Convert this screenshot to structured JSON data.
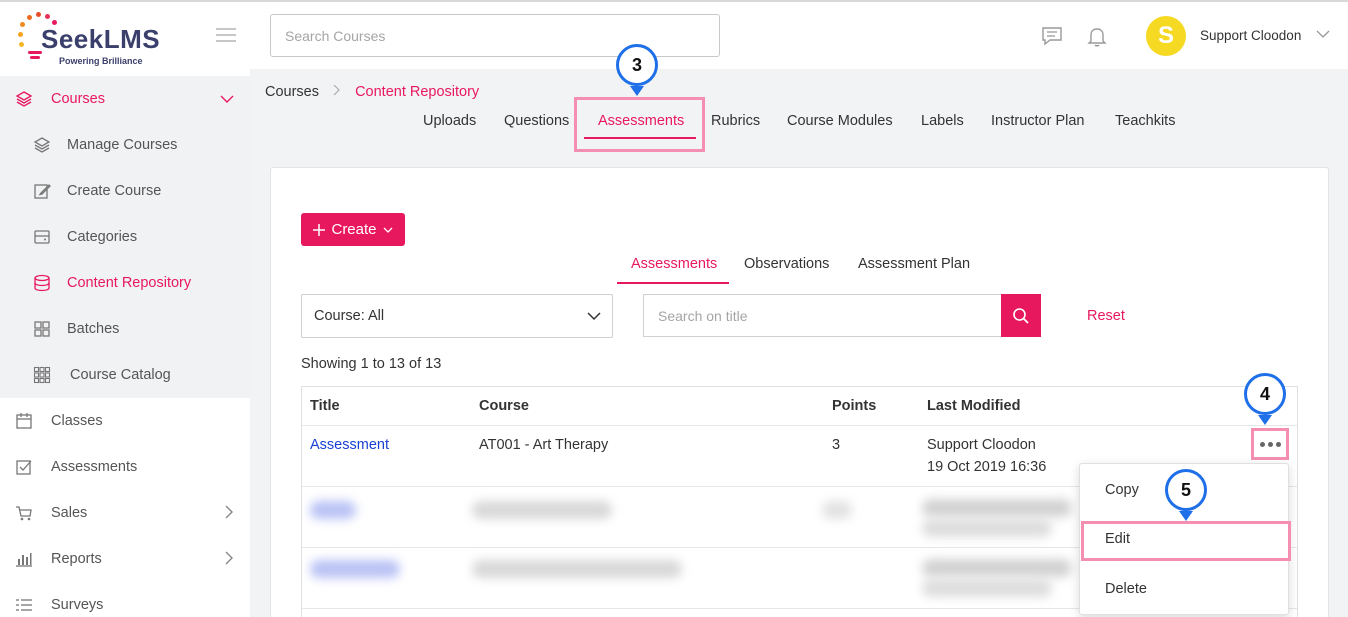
{
  "brand": {
    "name": "SeekLMS",
    "tagline": "Powering Brilliance"
  },
  "header": {
    "search_placeholder": "Search Courses",
    "user_name": "Support Cloodon",
    "user_initial": "S"
  },
  "sidebar": {
    "items": [
      {
        "label": "Courses",
        "icon": "layers-icon",
        "active": true,
        "expanded": true
      },
      {
        "label": "Manage Courses",
        "icon": "layers-icon",
        "sub": true
      },
      {
        "label": "Create Course",
        "icon": "edit-icon",
        "sub": true
      },
      {
        "label": "Categories",
        "icon": "server-icon",
        "sub": true
      },
      {
        "label": "Content Repository",
        "icon": "database-icon",
        "sub": true,
        "active": true
      },
      {
        "label": "Batches",
        "icon": "grid-icon",
        "sub": true
      },
      {
        "label": "Course Catalog",
        "icon": "apps-icon",
        "sub": true
      },
      {
        "label": "Classes",
        "icon": "calendar-icon"
      },
      {
        "label": "Assessments",
        "icon": "checkbox-icon"
      },
      {
        "label": "Sales",
        "icon": "cart-icon"
      },
      {
        "label": "Reports",
        "icon": "bar-chart-icon"
      },
      {
        "label": "Surveys",
        "icon": "list-icon"
      }
    ]
  },
  "breadcrumb": {
    "root": "Courses",
    "current": "Content Repository"
  },
  "repo_tabs": [
    "Uploads",
    "Questions",
    "Assessments",
    "Rubrics",
    "Course Modules",
    "Labels",
    "Instructor Plan",
    "Teachkits"
  ],
  "repo_tab_active": "Assessments",
  "create_label": "Create",
  "sub_tabs": [
    "Assessments",
    "Observations",
    "Assessment Plan"
  ],
  "filters": {
    "course_select": "Course: All",
    "title_placeholder": "Search on title",
    "reset_label": "Reset"
  },
  "showing_text": "Showing 1 to 13 of 13",
  "table": {
    "columns": [
      "Title",
      "Course",
      "Points",
      "Last Modified"
    ],
    "rows": [
      {
        "title": "Assessment",
        "course": "AT001 - Art Therapy",
        "points": "3",
        "modified_by": "Support Cloodon",
        "modified_at": "19 Oct 2019 16:36"
      }
    ]
  },
  "row_menu": [
    "Copy",
    "Edit",
    "Delete"
  ],
  "callouts": [
    "3",
    "4",
    "5"
  ],
  "colors": {
    "accent": "#e8185f",
    "callout_ring": "#1e6fe8",
    "highlight": "#f48fb1",
    "link": "#1a3fd6"
  }
}
